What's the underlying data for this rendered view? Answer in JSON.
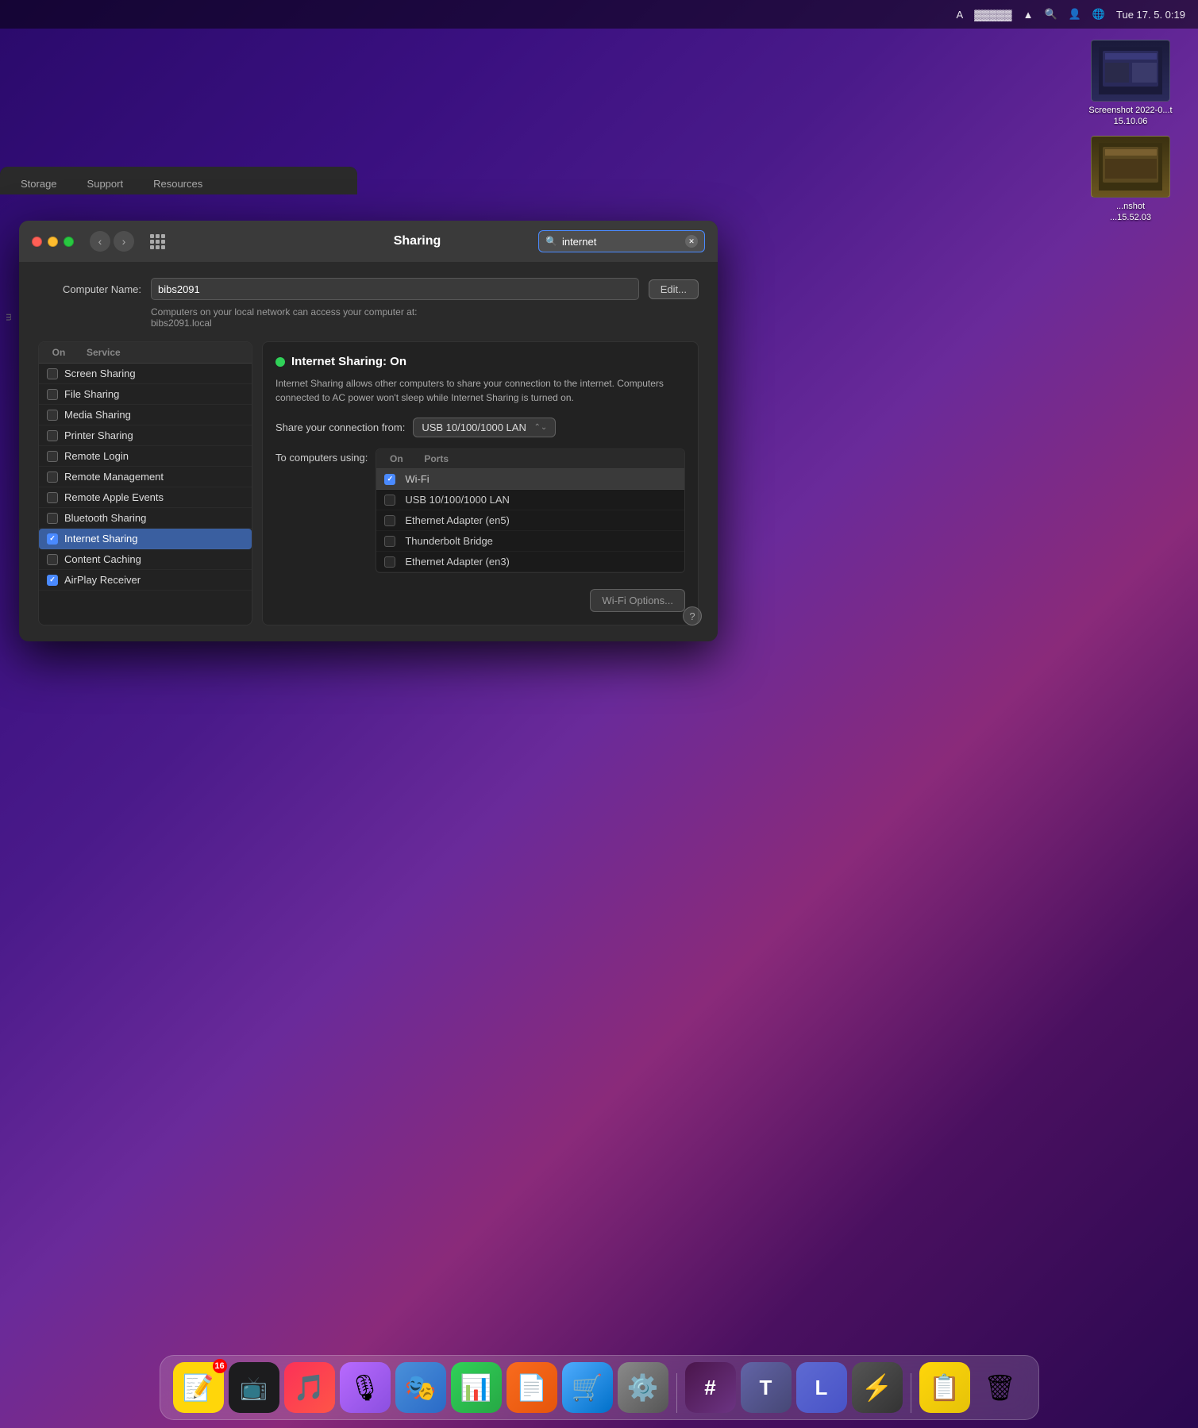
{
  "menubar": {
    "datetime": "Tue 17. 5.  0:19",
    "items": [
      "A",
      "🔋",
      "WiFi",
      "🔍",
      "👤",
      "🌐"
    ]
  },
  "desktop": {
    "icons": [
      {
        "label": "Screenshot\n2022-0...t 15.10.06",
        "type": "screenshot1"
      },
      {
        "label": "...nshot\n...15.52.03",
        "type": "screenshot2"
      }
    ]
  },
  "bg_window": {
    "tabs": [
      "Storage",
      "Support",
      "Resources"
    ]
  },
  "sharing_window": {
    "title": "Sharing",
    "search_placeholder": "internet",
    "search_value": "internet",
    "computer_name_label": "Computer Name:",
    "computer_name_value": "bibs2091",
    "local_network_text": "Computers on your local network can access your computer at:\nbibs2091.local",
    "edit_button": "Edit...",
    "services_header": {
      "on": "On",
      "service": "Service"
    },
    "services": [
      {
        "label": "Screen Sharing",
        "checked": false,
        "selected": false
      },
      {
        "label": "File Sharing",
        "checked": false,
        "selected": false
      },
      {
        "label": "Media Sharing",
        "checked": false,
        "selected": false
      },
      {
        "label": "Printer Sharing",
        "checked": false,
        "selected": false
      },
      {
        "label": "Remote Login",
        "checked": false,
        "selected": false
      },
      {
        "label": "Remote Management",
        "checked": false,
        "selected": false
      },
      {
        "label": "Remote Apple Events",
        "checked": false,
        "selected": false
      },
      {
        "label": "Bluetooth Sharing",
        "checked": false,
        "selected": false
      },
      {
        "label": "Internet Sharing",
        "checked": true,
        "selected": true
      },
      {
        "label": "Content Caching",
        "checked": false,
        "selected": false
      },
      {
        "label": "AirPlay Receiver",
        "checked": true,
        "selected": false
      }
    ],
    "right_panel": {
      "status": "Internet Sharing: On",
      "description": "Internet Sharing allows other computers to share your connection to the internet. Computers connected to AC power won't sleep while Internet Sharing is turned on.",
      "share_from_label": "Share your connection from:",
      "share_from_value": "USB 10/100/1000 LAN",
      "computers_using_label": "To computers using:",
      "ports_header": {
        "on": "On",
        "ports": "Ports"
      },
      "ports": [
        {
          "label": "Wi-Fi",
          "checked": true,
          "highlighted": true
        },
        {
          "label": "USB 10/100/1000 LAN",
          "checked": false,
          "highlighted": false
        },
        {
          "label": "Ethernet Adapter (en5)",
          "checked": false,
          "highlighted": false
        },
        {
          "label": "Thunderbolt Bridge",
          "checked": false,
          "highlighted": false
        },
        {
          "label": "Ethernet Adapter (en3)",
          "checked": false,
          "highlighted": false
        }
      ],
      "wifi_options_button": "Wi-Fi Options..."
    }
  },
  "dock": {
    "items": [
      {
        "name": "Notes",
        "class": "app-notes",
        "icon": "📝",
        "badge": "16"
      },
      {
        "name": "Apple TV",
        "class": "app-appletv",
        "icon": "📺"
      },
      {
        "name": "Music",
        "class": "app-music",
        "icon": "🎵"
      },
      {
        "name": "Podcasts",
        "class": "app-podcasts",
        "icon": "🎙"
      },
      {
        "name": "Keynote",
        "class": "app-keynote",
        "icon": "🎭"
      },
      {
        "name": "Numbers",
        "class": "app-numbers",
        "icon": "📊"
      },
      {
        "name": "Pages",
        "class": "app-pages",
        "icon": "📄"
      },
      {
        "name": "App Store",
        "class": "app-appstore",
        "icon": "🛒"
      },
      {
        "name": "System Preferences",
        "class": "app-sysprefs",
        "icon": "⚙️"
      },
      {
        "name": "Slack",
        "class": "app-slack",
        "icon": "#"
      },
      {
        "name": "Teams",
        "class": "app-teams",
        "icon": "T"
      },
      {
        "name": "Linear",
        "class": "app-linear",
        "icon": "L"
      },
      {
        "name": "Compressor",
        "class": "app-compressor",
        "icon": "⚡"
      },
      {
        "name": "Clipboard",
        "class": "app-clipboardmgr",
        "icon": "📋"
      },
      {
        "name": "Trash",
        "class": "app-trash",
        "icon": "🗑"
      }
    ]
  }
}
